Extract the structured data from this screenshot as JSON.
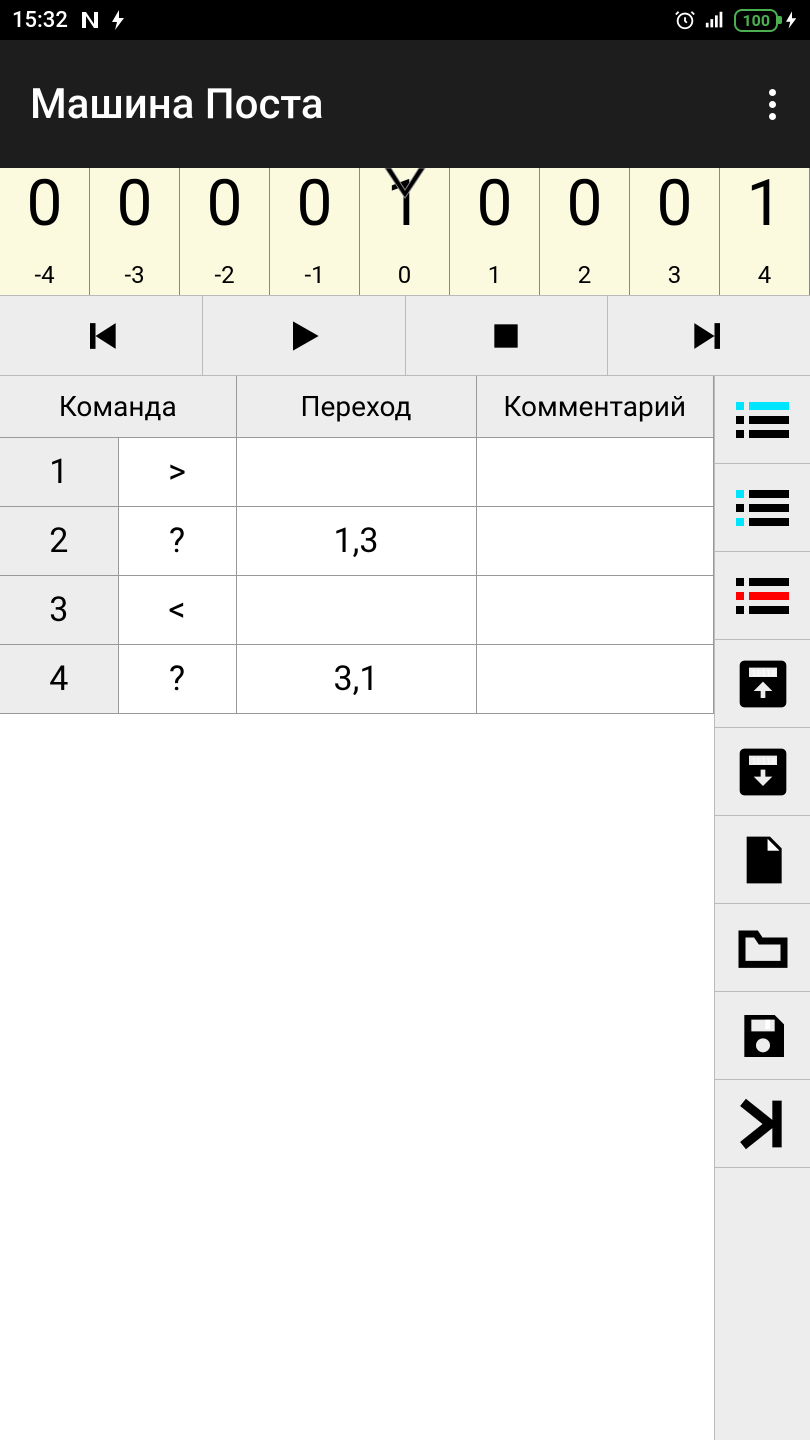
{
  "status": {
    "time": "15:32",
    "battery": "100"
  },
  "toolbar": {
    "title": "Машина Поста"
  },
  "tape": {
    "cells": [
      {
        "value": "0",
        "index": "-4"
      },
      {
        "value": "0",
        "index": "-3"
      },
      {
        "value": "0",
        "index": "-2"
      },
      {
        "value": "0",
        "index": "-1"
      },
      {
        "value": "1",
        "index": "0"
      },
      {
        "value": "0",
        "index": "1"
      },
      {
        "value": "0",
        "index": "2"
      },
      {
        "value": "0",
        "index": "3"
      },
      {
        "value": "1",
        "index": "4"
      }
    ]
  },
  "program": {
    "headers": {
      "command": "Команда",
      "transition": "Переход",
      "comment": "Комментарий"
    },
    "rows": [
      {
        "num": "1",
        "cmd": ">",
        "trans": "",
        "comment": ""
      },
      {
        "num": "2",
        "cmd": "?",
        "trans": "1,3",
        "comment": ""
      },
      {
        "num": "3",
        "cmd": "<",
        "trans": "",
        "comment": ""
      },
      {
        "num": "4",
        "cmd": "?",
        "trans": "3,1",
        "comment": ""
      }
    ]
  }
}
